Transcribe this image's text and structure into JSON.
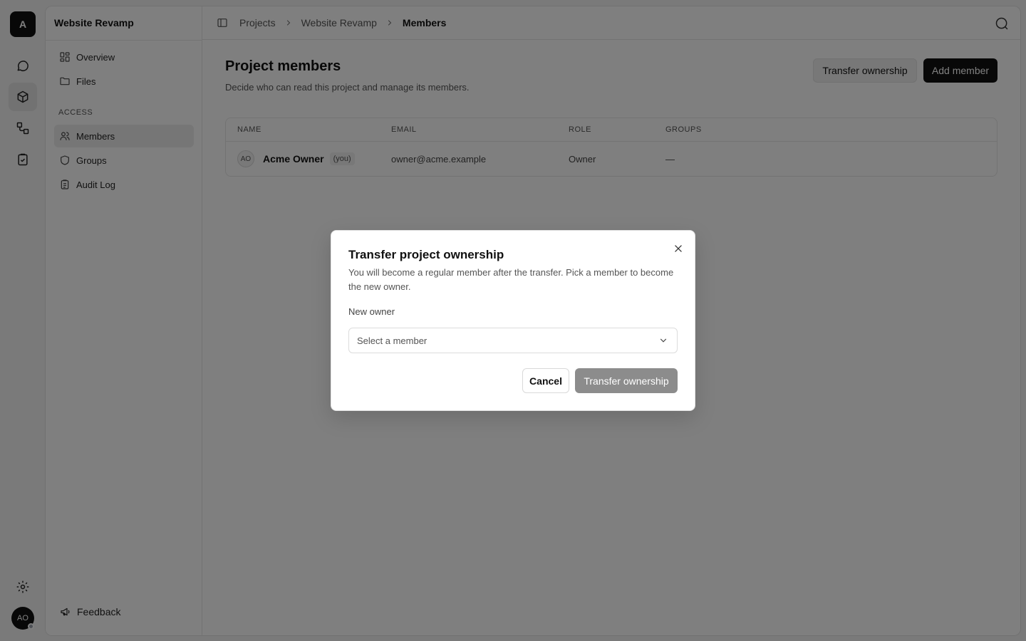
{
  "rail": {
    "logo_letter": "A",
    "user_initials": "AO",
    "items": [
      "chat-icon",
      "box-icon",
      "workflow-icon",
      "clipboard-check-icon"
    ],
    "settings_icon": "gear-icon"
  },
  "sidebar": {
    "project_name": "Website Revamp",
    "items": [
      {
        "label": "Overview",
        "icon": "dashboard-icon"
      },
      {
        "label": "Files",
        "icon": "folder-icon"
      }
    ],
    "section_label": "ACCESS",
    "access_items": [
      {
        "label": "Members",
        "icon": "users-icon",
        "active": true
      },
      {
        "label": "Groups",
        "icon": "shield-icon"
      },
      {
        "label": "Audit Log",
        "icon": "clipboard-icon"
      }
    ],
    "feedback_label": "Feedback"
  },
  "topbar": {
    "breadcrumbs": [
      "Projects",
      "Website Revamp",
      "Members"
    ]
  },
  "page": {
    "title": "Project members",
    "subtitle": "Decide who can read this project and manage its members.",
    "transfer_label": "Transfer ownership",
    "add_label": "Add member"
  },
  "table": {
    "columns": [
      "NAME",
      "EMAIL",
      "ROLE",
      "GROUPS"
    ],
    "rows": [
      {
        "initials": "AO",
        "name": "Acme Owner",
        "badge": "(you)",
        "email": "owner@acme.example",
        "role": "Owner",
        "groups": "—"
      }
    ]
  },
  "modal": {
    "title": "Transfer project ownership",
    "description": "You will become a regular member after the transfer. Pick a member to become the new owner.",
    "field_label": "New owner",
    "select_placeholder": "Select a member",
    "cancel_label": "Cancel",
    "confirm_label": "Transfer ownership"
  }
}
